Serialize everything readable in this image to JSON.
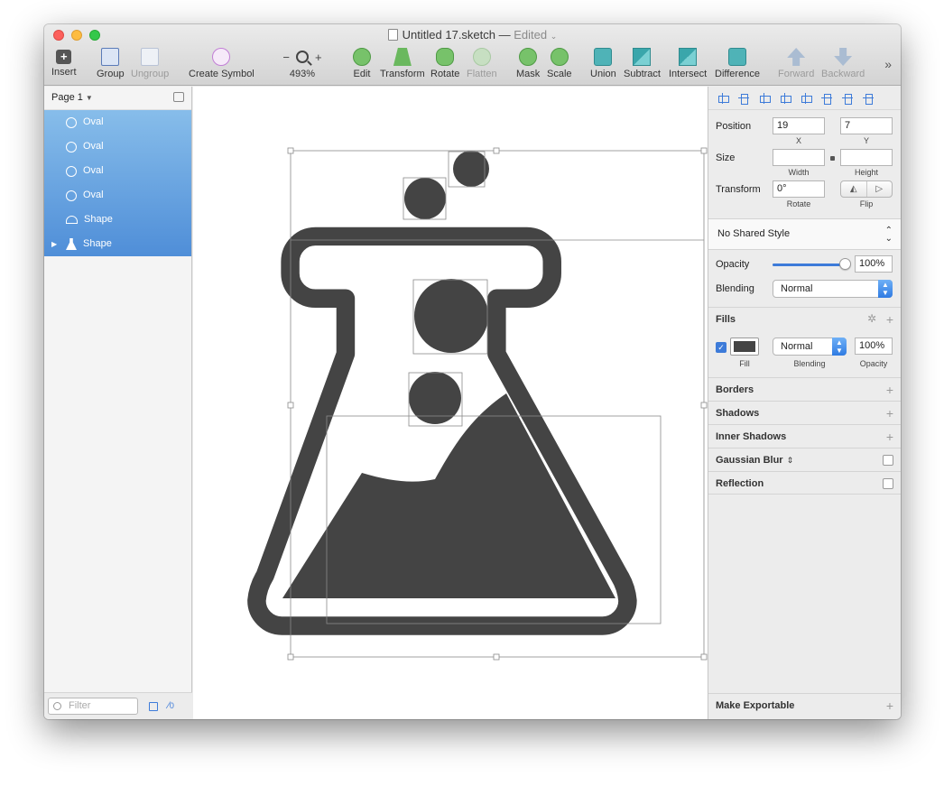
{
  "window": {
    "title": "Untitled 17.sketch",
    "title_sep": "—",
    "edited": "Edited",
    "chevron": "⌄"
  },
  "toolbar": {
    "insert": "Insert",
    "group": "Group",
    "ungroup": "Ungroup",
    "create_symbol": "Create Symbol",
    "zoom_minus": "−",
    "zoom_plus": "+",
    "zoom_level": "493%",
    "edit": "Edit",
    "transform": "Transform",
    "rotate": "Rotate",
    "flatten": "Flatten",
    "mask": "Mask",
    "scale": "Scale",
    "union": "Union",
    "subtract": "Subtract",
    "intersect": "Intersect",
    "difference": "Difference",
    "forward": "Forward",
    "backward": "Backward",
    "more": "»"
  },
  "layers": {
    "page": "Page 1",
    "items": [
      {
        "name": "Oval",
        "kind": "oval"
      },
      {
        "name": "Oval",
        "kind": "oval"
      },
      {
        "name": "Oval",
        "kind": "oval"
      },
      {
        "name": "Oval",
        "kind": "oval"
      },
      {
        "name": "Shape",
        "kind": "shape"
      },
      {
        "name": "Shape",
        "kind": "flask"
      }
    ],
    "filter_placeholder": "Filter",
    "slice_count": "0"
  },
  "inspector": {
    "position_label": "Position",
    "x": "19",
    "y": "7",
    "x_sub": "X",
    "y_sub": "Y",
    "size_label": "Size",
    "width": "",
    "height": "",
    "width_sub": "Width",
    "height_sub": "Height",
    "transform_label": "Transform",
    "rotate": "0°",
    "rotate_sub": "Rotate",
    "flip_sub": "Flip",
    "shared_style": "No Shared Style",
    "opacity_label": "Opacity",
    "opacity_value": "100%",
    "opacity_level": 1.0,
    "blending_label": "Blending",
    "blending_value": "Normal",
    "fills_label": "Fills",
    "fill_blend": "Normal",
    "fill_opacity": "100%",
    "fill_sub": "Fill",
    "fill_blend_sub": "Blending",
    "fill_opacity_sub": "Opacity",
    "fill_color": "#444444",
    "borders": "Borders",
    "shadows": "Shadows",
    "inner_shadows": "Inner Shadows",
    "gaussian_blur": "Gaussian Blur",
    "reflection": "Reflection",
    "make_exportable": "Make Exportable"
  },
  "colors": {
    "selection": "#4f8ed8",
    "accent": "#3d7bd9",
    "artwork": "#444444"
  }
}
